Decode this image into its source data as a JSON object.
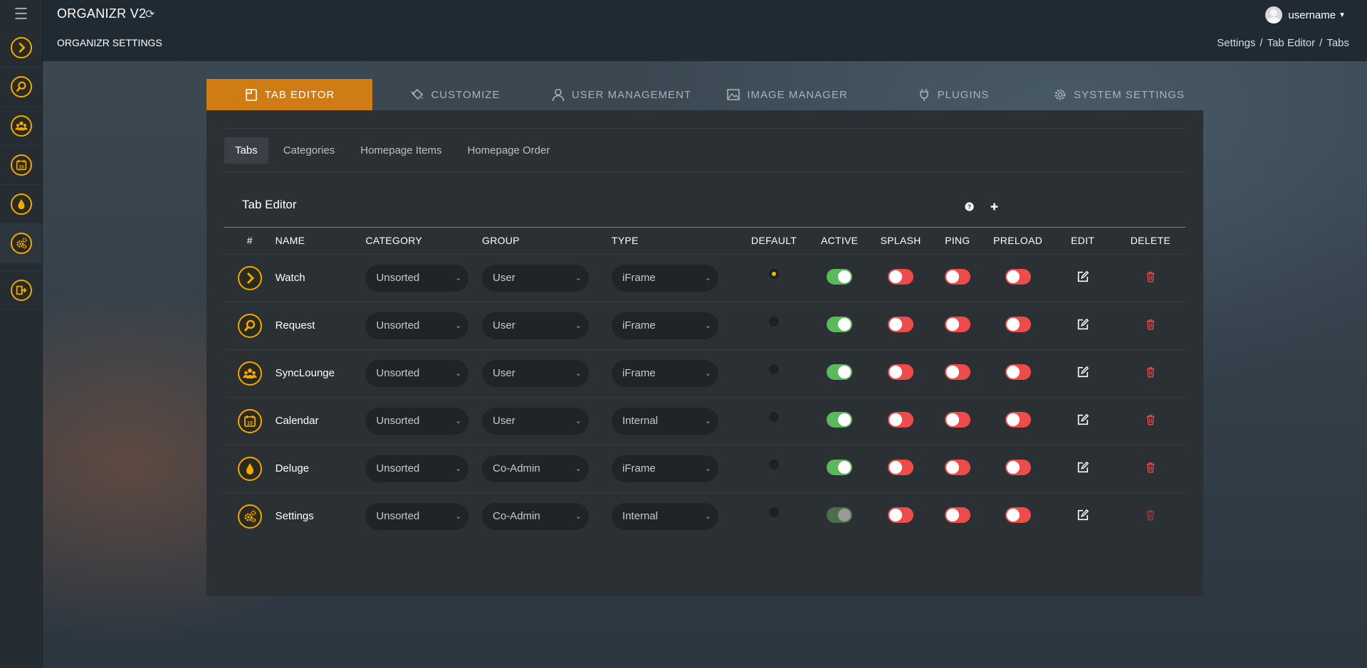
{
  "colors": {
    "accent": "#cf7c15",
    "icon_gold": "#f2a900",
    "toggle_on": "#5cb85c",
    "toggle_off": "#ee4b4b",
    "delete_red": "#e04848"
  },
  "sidebar": {
    "menu_icon": "hamburger-icon",
    "items": [
      {
        "name": "watch",
        "icon": "chevron-right-icon"
      },
      {
        "name": "request",
        "icon": "search-icon"
      },
      {
        "name": "synclounge",
        "icon": "group-icon"
      },
      {
        "name": "calendar",
        "icon": "calendar-icon"
      },
      {
        "name": "deluge",
        "icon": "drop-icon"
      },
      {
        "name": "settings",
        "icon": "gears-icon"
      }
    ],
    "logout_icon": "logout-icon"
  },
  "header": {
    "app_title": "ORGANIZR V2",
    "section_title": "ORGANIZR SETTINGS",
    "username": "username",
    "breadcrumb": [
      "Settings",
      "Tab Editor",
      "Tabs"
    ],
    "breadcrumb_sep": "/"
  },
  "main_tabs": [
    {
      "label": "TAB EDITOR",
      "icon": "tab-icon",
      "active": true
    },
    {
      "label": "CUSTOMIZE",
      "icon": "paint-bucket-icon",
      "active": false
    },
    {
      "label": "USER MANAGEMENT",
      "icon": "user-icon",
      "active": false
    },
    {
      "label": "IMAGE MANAGER",
      "icon": "image-icon",
      "active": false
    },
    {
      "label": "PLUGINS",
      "icon": "plug-icon",
      "active": false
    },
    {
      "label": "SYSTEM SETTINGS",
      "icon": "gear-icon",
      "active": false
    }
  ],
  "sub_tabs": [
    {
      "label": "Tabs",
      "active": true
    },
    {
      "label": "Categories",
      "active": false
    },
    {
      "label": "Homepage Items",
      "active": false
    },
    {
      "label": "Homepage Order",
      "active": false
    }
  ],
  "editor": {
    "title": "Tab Editor",
    "help_icon": "help-icon",
    "add_icon": "plus-icon",
    "columns": [
      "#",
      "NAME",
      "CATEGORY",
      "GROUP",
      "TYPE",
      "DEFAULT",
      "ACTIVE",
      "SPLASH",
      "PING",
      "PRELOAD",
      "EDIT",
      "DELETE"
    ],
    "rows": [
      {
        "icon": "chevron-right-icon",
        "name": "Watch",
        "category": "Unsorted",
        "group": "User",
        "type": "iFrame",
        "default": true,
        "active": true,
        "active_disabled": false,
        "splash": false,
        "ping": false,
        "preload": false,
        "delete_disabled": false
      },
      {
        "icon": "search-icon",
        "name": "Request",
        "category": "Unsorted",
        "group": "User",
        "type": "iFrame",
        "default": false,
        "active": true,
        "active_disabled": false,
        "splash": false,
        "ping": false,
        "preload": false,
        "delete_disabled": false
      },
      {
        "icon": "group-icon",
        "name": "SyncLounge",
        "category": "Unsorted",
        "group": "User",
        "type": "iFrame",
        "default": false,
        "active": true,
        "active_disabled": false,
        "splash": false,
        "ping": false,
        "preload": false,
        "delete_disabled": false
      },
      {
        "icon": "calendar-icon",
        "name": "Calendar",
        "category": "Unsorted",
        "group": "User",
        "type": "Internal",
        "default": false,
        "active": true,
        "active_disabled": false,
        "splash": false,
        "ping": false,
        "preload": false,
        "delete_disabled": false
      },
      {
        "icon": "drop-icon",
        "name": "Deluge",
        "category": "Unsorted",
        "group": "Co-Admin",
        "type": "iFrame",
        "default": false,
        "active": true,
        "active_disabled": false,
        "splash": false,
        "ping": false,
        "preload": false,
        "delete_disabled": false
      },
      {
        "icon": "gears-icon",
        "name": "Settings",
        "category": "Unsorted",
        "group": "Co-Admin",
        "type": "Internal",
        "default": false,
        "active": true,
        "active_disabled": true,
        "splash": false,
        "ping": false,
        "preload": false,
        "delete_disabled": true
      }
    ]
  }
}
